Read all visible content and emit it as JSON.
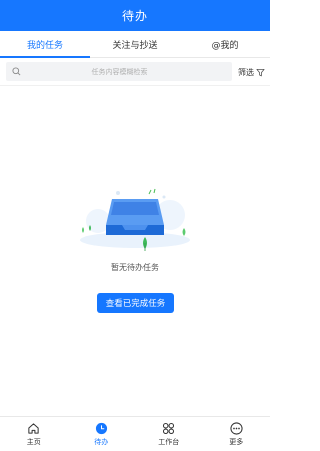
{
  "header": {
    "title": "待办"
  },
  "tabs": [
    {
      "label": "我的任务",
      "active": true
    },
    {
      "label": "关注与抄送",
      "active": false
    },
    {
      "label": "@我的",
      "active": false
    }
  ],
  "search": {
    "placeholder": "任务内容模糊检索",
    "icon": "search-icon"
  },
  "filter": {
    "label": "筛选",
    "icon": "filter-icon"
  },
  "empty_state": {
    "message": "暂无待办任务",
    "illustration": "empty-inbox-illustration"
  },
  "action_button": {
    "label": "查看已完成任务"
  },
  "bottom_nav": [
    {
      "label": "主页",
      "icon": "home-icon",
      "active": false
    },
    {
      "label": "待办",
      "icon": "clock-icon",
      "active": true
    },
    {
      "label": "工作台",
      "icon": "workbench-icon",
      "active": false
    },
    {
      "label": "更多",
      "icon": "more-icon",
      "active": false
    }
  ],
  "colors": {
    "primary": "#1677ff",
    "background": "#ffffff",
    "divider": "#e8e8e8"
  }
}
